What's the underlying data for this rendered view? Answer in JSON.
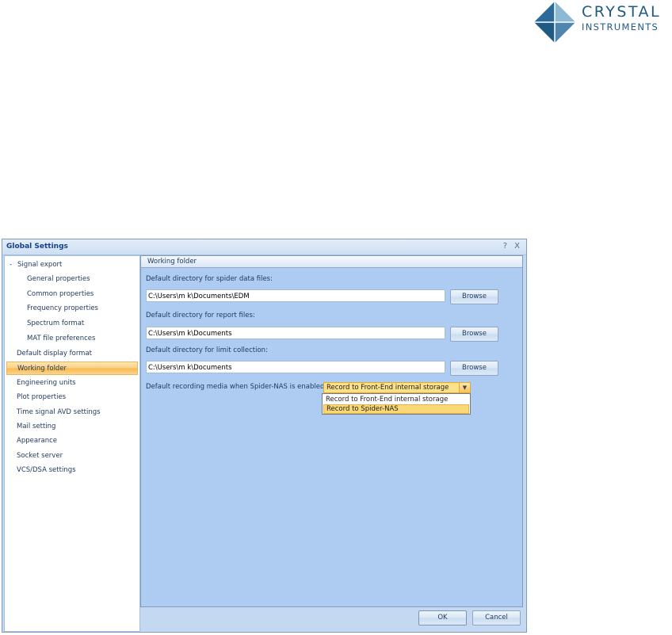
{
  "logo": {
    "line1": "CRYSTAL",
    "line2": "INSTRUMENTS"
  },
  "window": {
    "title": "Global Settings",
    "help_glyph": "?",
    "close_glyph": "X"
  },
  "nav": {
    "items": [
      {
        "label": "Signal export",
        "expander": "-"
      },
      {
        "label": "General properties"
      },
      {
        "label": "Common properties"
      },
      {
        "label": "Frequency properties"
      },
      {
        "label": "Spectrum format"
      },
      {
        "label": "MAT file preferences"
      },
      {
        "label": "Default display format"
      },
      {
        "label": "Working folder",
        "selected": true
      },
      {
        "label": "Engineering units"
      },
      {
        "label": "Plot properties"
      },
      {
        "label": "Time signal AVD settings"
      },
      {
        "label": "Mail setting"
      },
      {
        "label": "Appearance"
      },
      {
        "label": "Socket server"
      },
      {
        "label": "VCS/DSA settings"
      }
    ]
  },
  "panel": {
    "header": "Working folder",
    "spider_label": "Default directory for spider data files:",
    "spider_value": "C:\\Users\\m k\\Documents\\EDM",
    "report_label": "Default directory for report files:",
    "report_value": "C:\\Users\\m k\\Documents",
    "limit_label": "Default directory for limit collection:",
    "limit_value": "C:\\Users\\m k\\Documents",
    "browse_label": "Browse",
    "media_label": "Default recording media when Spider-NAS is enabled:",
    "media_selected": "Record to Front-End internal storage",
    "media_options": [
      "Record to Front-End internal storage",
      "Record to Spider-NAS"
    ]
  },
  "buttons": {
    "ok": "OK",
    "cancel": "Cancel"
  },
  "colors": {
    "selection": "#fbcf80",
    "panel": "#aecbf2",
    "frame": "#c4d9f1"
  }
}
